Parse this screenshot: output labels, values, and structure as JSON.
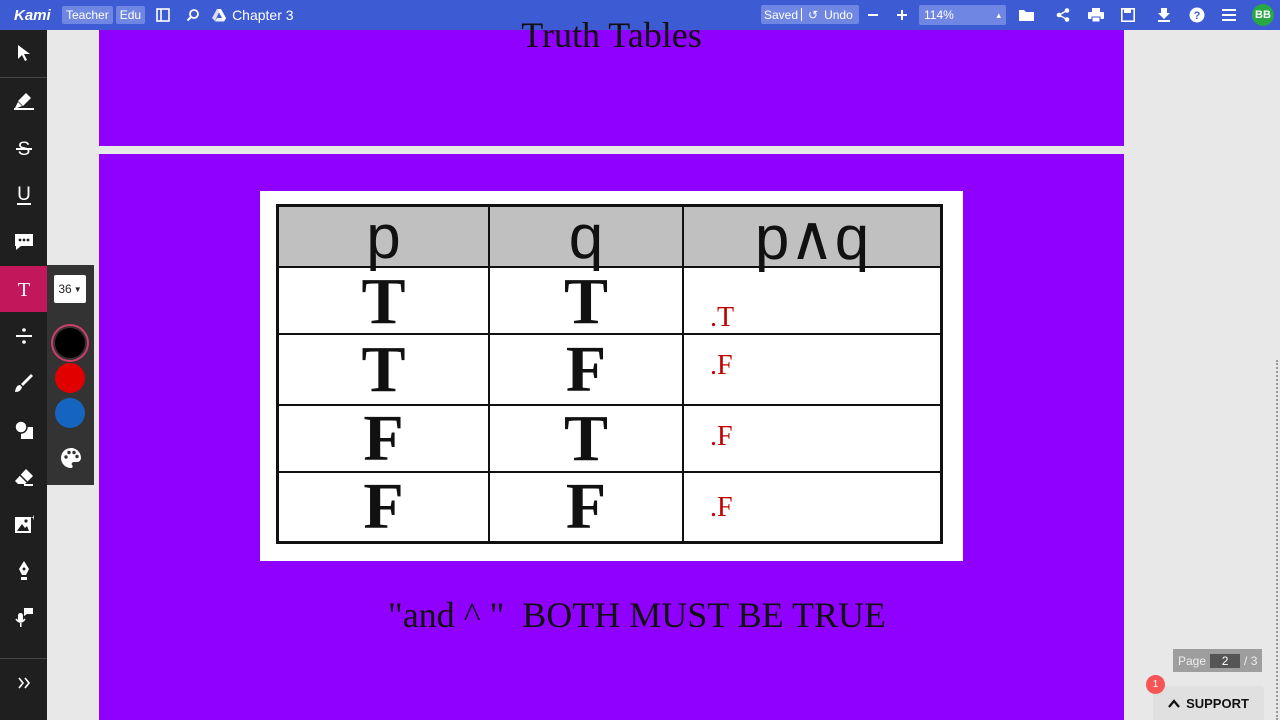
{
  "topbar": {
    "logo": "Kami",
    "chips": [
      "Teacher",
      "Edu"
    ],
    "doc_title": "Chapter 3",
    "saved": "Saved",
    "undo": "Undo",
    "zoom": "114%",
    "avatar": "BB"
  },
  "left_toolbar": {
    "tools": [
      "select",
      "highlight",
      "strikethrough",
      "underline",
      "comment",
      "text",
      "equation",
      "draw",
      "shapes",
      "eraser",
      "add-image",
      "signature",
      "audio-comment"
    ],
    "active_tool": "text"
  },
  "text_panel": {
    "font_size": "36",
    "colors": [
      "#000000",
      "#e00000",
      "#1565c0"
    ],
    "selected_color": "#000000"
  },
  "document": {
    "page1_title": "Truth Tables",
    "table": {
      "headers": [
        "p",
        "q",
        "p∧q"
      ],
      "rows": [
        [
          "T",
          "T",
          ".T"
        ],
        [
          "T",
          "F",
          ".F"
        ],
        [
          "F",
          "T",
          ".F"
        ],
        [
          "F",
          "F",
          ".F"
        ]
      ]
    },
    "caption": "\"and ^ \"  BOTH MUST BE TRUE"
  },
  "page_indicator": {
    "label": "Page",
    "current": "2",
    "total": "/ 3"
  },
  "support": {
    "label": "SUPPORT",
    "badge": "1"
  },
  "colors": {
    "topbar": "#3d5bd3",
    "page_bg": "#9000ff",
    "annotation": "#c00000"
  }
}
